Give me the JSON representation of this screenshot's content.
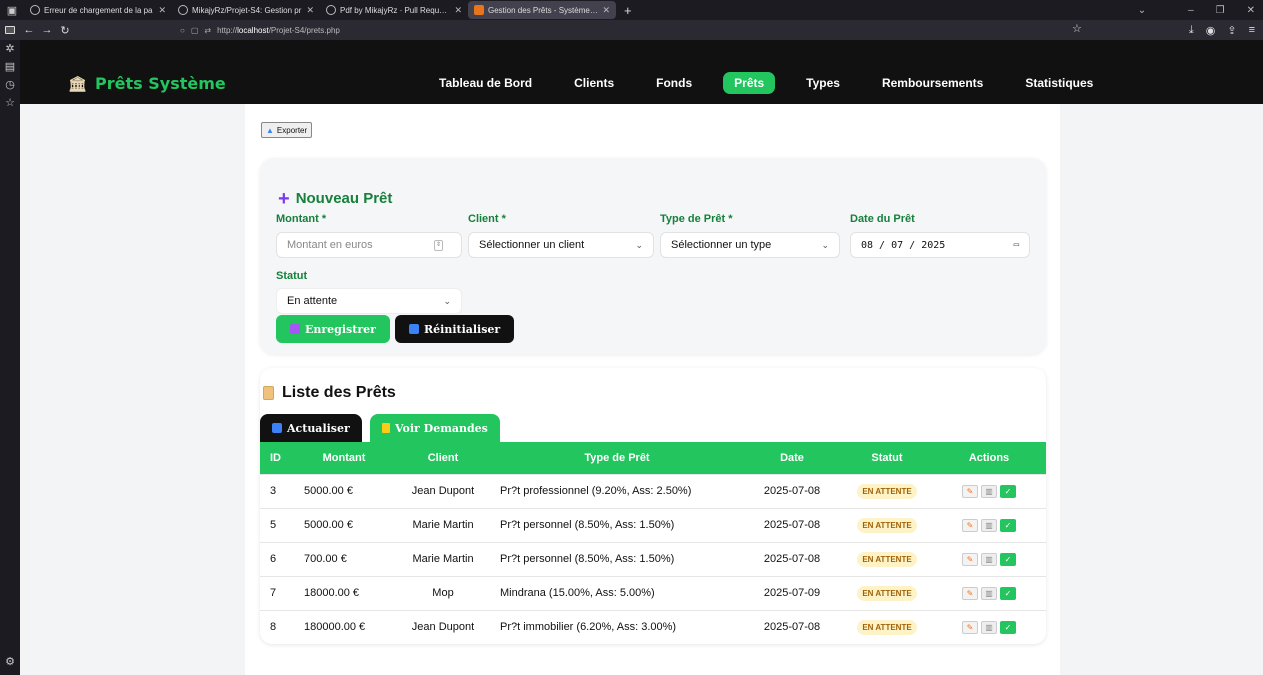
{
  "browser": {
    "tabs": [
      {
        "title": "Erreur de chargement de la pa"
      },
      {
        "title": "MikajyRz/Projet-S4: Gestion pr"
      },
      {
        "title": "Pdf by MikajyRz · Pull Request #"
      },
      {
        "title": "Gestion des Prêts - Système de"
      }
    ],
    "url_prefix": "http://",
    "url_host": "localhost",
    "url_path": "/Projet-S4/prets.php"
  },
  "app": {
    "brand": "Prêts Système",
    "menu": [
      "Tableau de Bord",
      "Clients",
      "Fonds",
      "Prêts",
      "Types",
      "Remboursements",
      "Statistiques"
    ],
    "active_menu": "Prêts"
  },
  "export_label": "Exporter",
  "form": {
    "title": "Nouveau Prêt",
    "montant_label": "Montant *",
    "montant_placeholder": "Montant en euros",
    "client_label": "Client *",
    "client_value": "Sélectionner un client",
    "type_label": "Type de Prêt *",
    "type_value": "Sélectionner un type",
    "date_label": "Date du Prêt",
    "date_value": "08 / 07 / 2025",
    "statut_label": "Statut",
    "statut_value": "En attente",
    "save_label": "Enregistrer",
    "reset_label": "Réinitialiser"
  },
  "list": {
    "title": "Liste des Prêts",
    "refresh_label": "Actualiser",
    "requests_label": "Voir Demandes",
    "columns": [
      "ID",
      "Montant",
      "Client",
      "Type de Prêt",
      "Date",
      "Statut",
      "Actions"
    ],
    "rows": [
      {
        "id": "3",
        "montant": "5000.00 €",
        "client": "Jean Dupont",
        "type": "Pr?t professionnel (9.20%, Ass: 2.50%)",
        "date": "2025-07-08",
        "statut": "EN ATTENTE"
      },
      {
        "id": "5",
        "montant": "5000.00 €",
        "client": "Marie Martin",
        "type": "Pr?t personnel (8.50%, Ass: 1.50%)",
        "date": "2025-07-08",
        "statut": "EN ATTENTE"
      },
      {
        "id": "6",
        "montant": "700.00 €",
        "client": "Marie Martin",
        "type": "Pr?t personnel (8.50%, Ass: 1.50%)",
        "date": "2025-07-08",
        "statut": "EN ATTENTE"
      },
      {
        "id": "7",
        "montant": "18000.00 €",
        "client": "Mop",
        "type": "Mindrana (15.00%, Ass: 5.00%)",
        "date": "2025-07-09",
        "statut": "EN ATTENTE"
      },
      {
        "id": "8",
        "montant": "180000.00 €",
        "client": "Jean Dupont",
        "type": "Pr?t immobilier (6.20%, Ass: 3.00%)",
        "date": "2025-07-08",
        "statut": "EN ATTENTE"
      }
    ]
  },
  "colors": {
    "accent": "#22c55e",
    "dark": "#111111",
    "badge_bg": "#fdf3c6"
  }
}
